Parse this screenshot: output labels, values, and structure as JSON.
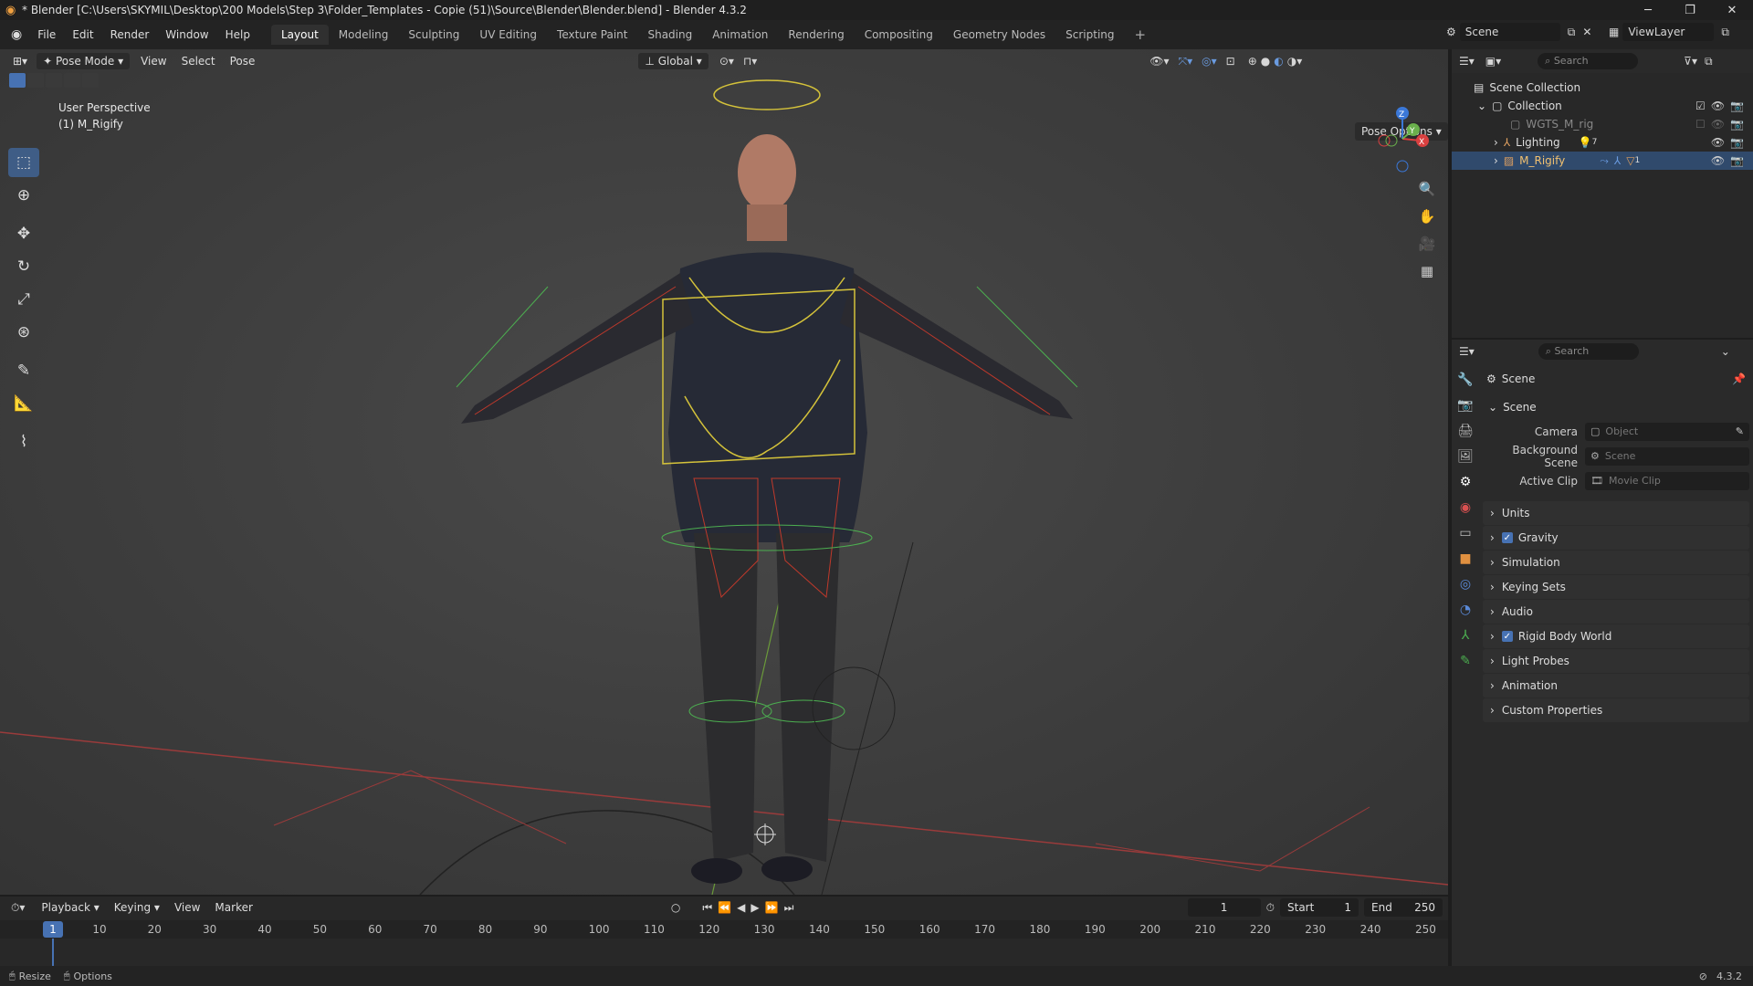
{
  "title": "* Blender [C:\\Users\\SKYMIL\\Desktop\\200 Models\\Step 3\\Folder_Templates - Copie (51)\\Source\\Blender\\Blender.blend] - Blender 4.3.2",
  "menu": [
    "File",
    "Edit",
    "Render",
    "Window",
    "Help"
  ],
  "workspaces": [
    "Layout",
    "Modeling",
    "Sculpting",
    "UV Editing",
    "Texture Paint",
    "Shading",
    "Animation",
    "Rendering",
    "Compositing",
    "Geometry Nodes",
    "Scripting"
  ],
  "active_workspace": "Layout",
  "scene_name": "Scene",
  "view_layer": "ViewLayer",
  "viewport": {
    "mode": "Pose Mode",
    "menus": [
      "View",
      "Select",
      "Pose"
    ],
    "orientation": "Global",
    "pose_options": "Pose Options",
    "info_line1": "User Perspective",
    "info_line2": "(1) M_Rigify"
  },
  "outliner": {
    "search_placeholder": "Search",
    "rows": [
      {
        "label": "Scene Collection"
      },
      {
        "label": "Collection"
      },
      {
        "label": "WGTS_M_rig"
      },
      {
        "label": "Lighting",
        "badge": "7"
      },
      {
        "label": "M_Rigify",
        "badge": "1"
      }
    ]
  },
  "properties": {
    "search_placeholder": "Search",
    "header": "Scene",
    "section": "Scene",
    "fields": [
      {
        "label": "Camera",
        "placeholder": "Object"
      },
      {
        "label": "Background Scene",
        "placeholder": "Scene"
      },
      {
        "label": "Active Clip",
        "placeholder": "Movie Clip"
      }
    ],
    "panels": [
      {
        "label": "Units",
        "check": false
      },
      {
        "label": "Gravity",
        "check": true
      },
      {
        "label": "Simulation",
        "check": false
      },
      {
        "label": "Keying Sets",
        "check": false
      },
      {
        "label": "Audio",
        "check": false
      },
      {
        "label": "Rigid Body World",
        "check": true
      },
      {
        "label": "Light Probes",
        "check": false
      },
      {
        "label": "Animation",
        "check": false
      },
      {
        "label": "Custom Properties",
        "check": false
      }
    ]
  },
  "timeline": {
    "menus": [
      "Playback",
      "Keying",
      "View",
      "Marker"
    ],
    "current_frame": "1",
    "start_label": "Start",
    "start": "1",
    "end_label": "End",
    "end": "250",
    "ticks": [
      "10",
      "20",
      "30",
      "40",
      "50",
      "60",
      "70",
      "80",
      "90",
      "100",
      "110",
      "120",
      "130",
      "140",
      "150",
      "160",
      "170",
      "180",
      "190",
      "200",
      "210",
      "220",
      "230",
      "240",
      "250"
    ]
  },
  "status": {
    "resize": "Resize",
    "options": "Options",
    "version": "4.3.2"
  },
  "colors": {
    "accent": "#4772b3",
    "bone_yellow": "#d4c23a",
    "bone_red": "#c0392b",
    "bone_green": "#4caf50"
  }
}
